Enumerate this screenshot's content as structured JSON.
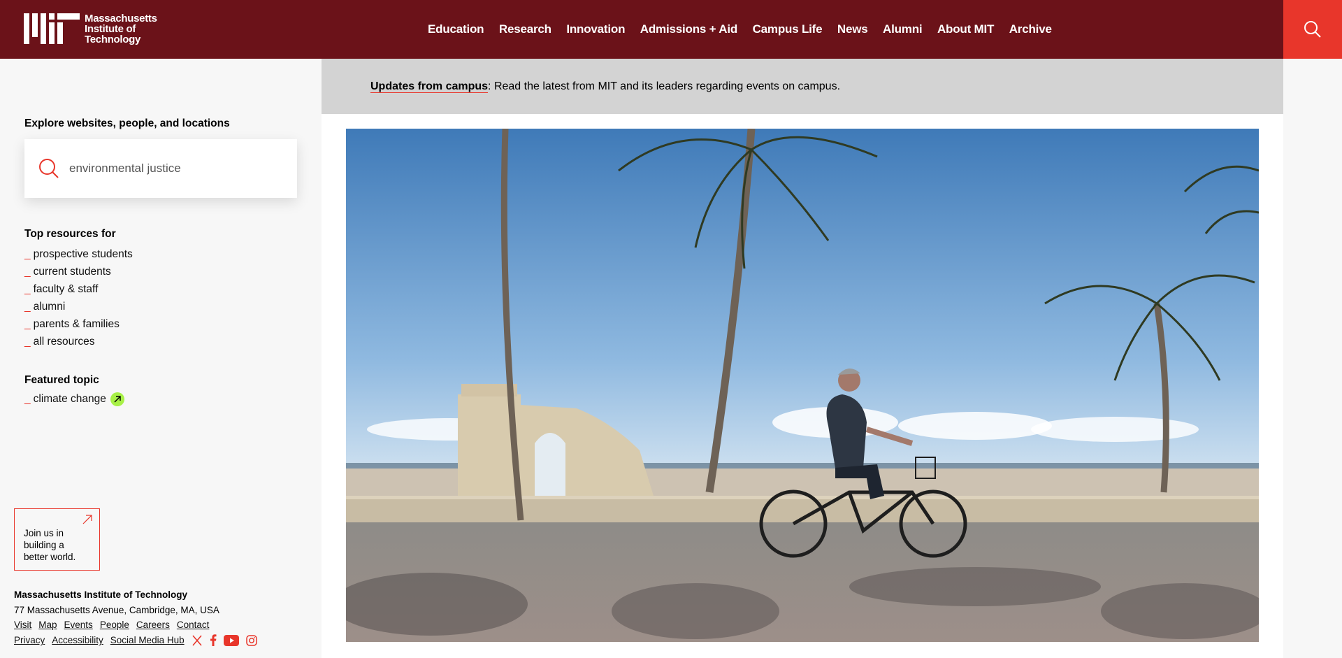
{
  "header": {
    "logo_lines": [
      "Massachusetts",
      "Institute of",
      "Technology"
    ],
    "nav": [
      "Education",
      "Research",
      "Innovation",
      "Admissions + Aid",
      "Campus Life",
      "News",
      "Alumni",
      "About MIT",
      "Archive"
    ],
    "search_icon": "search-icon"
  },
  "sidebar": {
    "explore_label": "Explore websites, people, and locations",
    "search_value": "environmental justice",
    "top_resources_title": "Top resources for",
    "resources": [
      "prospective students",
      "current students",
      "faculty & staff",
      "alumni",
      "parents & families",
      "all resources"
    ],
    "featured_title": "Featured topic",
    "featured_item": "climate change",
    "join_text": "Join us in building a better world.",
    "footer": {
      "name": "Massachusetts Institute of Technology",
      "address": "77 Massachusetts Avenue, Cambridge, MA, USA",
      "links_row1": [
        "Visit",
        "Map",
        "Events",
        "People",
        "Careers",
        "Contact"
      ],
      "links_row2": [
        "Privacy",
        "Accessibility",
        "Social Media Hub"
      ],
      "social_icons": [
        "x-icon",
        "facebook-icon",
        "youtube-icon",
        "instagram-icon"
      ]
    }
  },
  "banner": {
    "link_text": "Updates from campus",
    "text": ": Read the latest from MIT and its leaders regarding events on campus."
  },
  "colors": {
    "header_bg": "#6b1219",
    "accent_red": "#e8362b",
    "banner_bg": "#d3d3d3",
    "featured_badge": "#a7f046"
  }
}
